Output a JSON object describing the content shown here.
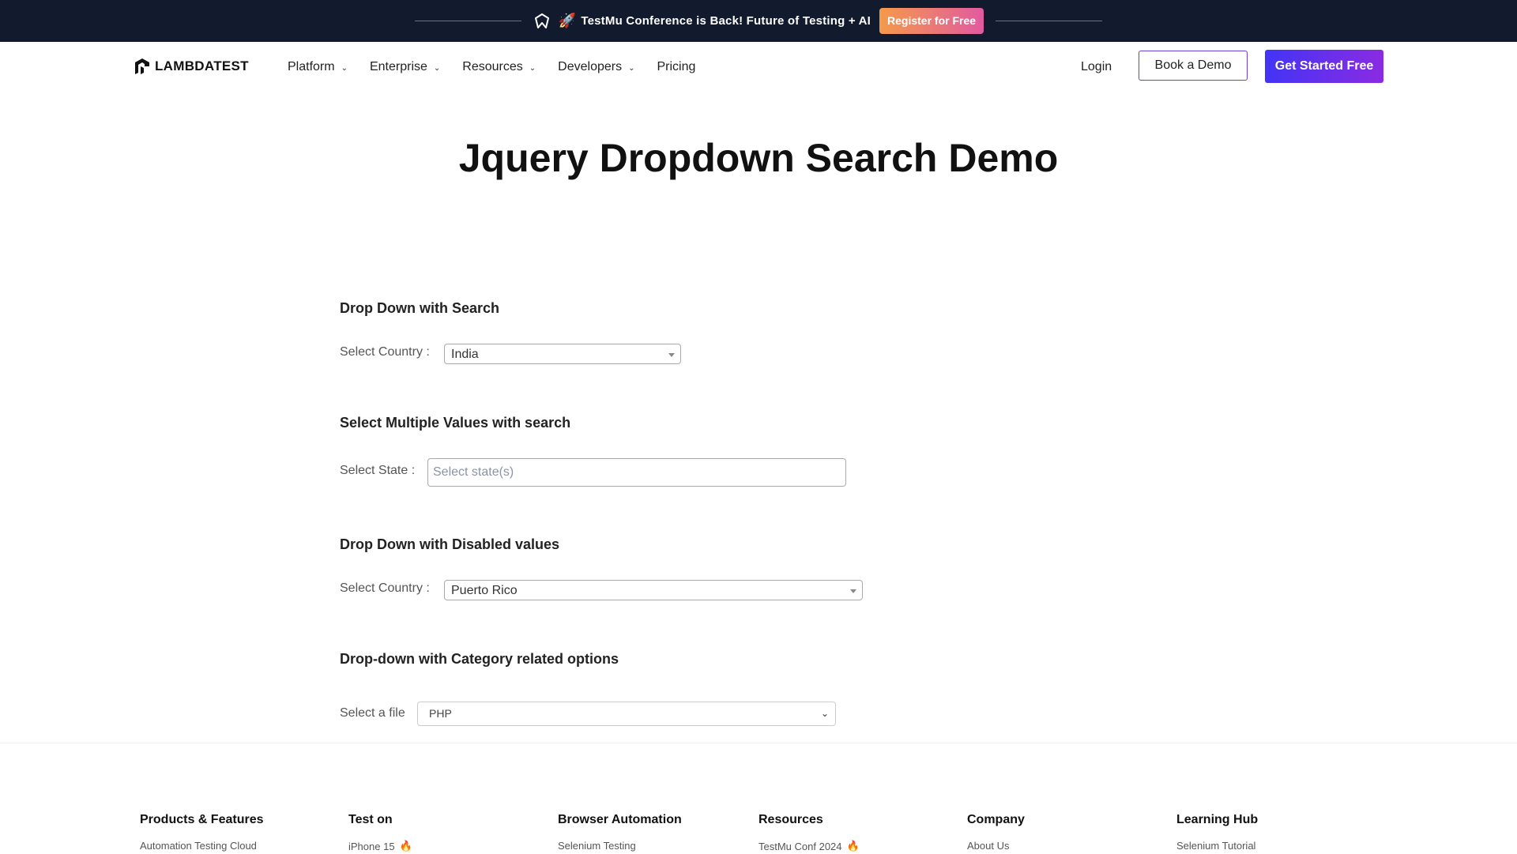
{
  "banner": {
    "logo_icon": "testmu-logo-icon",
    "rocket_icon": "rocket-icon",
    "text": "TestMu Conference is Back! Future of Testing + AI",
    "button": "Register for Free"
  },
  "nav": {
    "logo_text": "LAMBDATEST",
    "items": [
      {
        "label": "Platform",
        "has_dropdown": true
      },
      {
        "label": "Enterprise",
        "has_dropdown": true
      },
      {
        "label": "Resources",
        "has_dropdown": true
      },
      {
        "label": "Developers",
        "has_dropdown": true
      },
      {
        "label": "Pricing",
        "has_dropdown": false
      }
    ],
    "login": "Login",
    "book_demo": "Book a Demo",
    "get_started": "Get Started Free"
  },
  "page": {
    "title": "Jquery Dropdown Search Demo"
  },
  "sections": {
    "search": {
      "heading": "Drop Down with Search",
      "label": "Select Country :",
      "value": "India"
    },
    "multiple": {
      "heading": "Select Multiple Values with search",
      "label": "Select State :",
      "placeholder": "Select state(s)"
    },
    "disabled": {
      "heading": "Drop Down with Disabled values",
      "label": "Select Country :",
      "value": "Puerto Rico"
    },
    "category": {
      "heading": "Drop-down with Category related options",
      "label": "Select a file",
      "value": "PHP"
    }
  },
  "footer": {
    "columns": [
      {
        "heading": "Products & Features",
        "link": "Automation Testing Cloud",
        "fire": false
      },
      {
        "heading": "Test on",
        "link": "iPhone 15",
        "fire": true
      },
      {
        "heading": "Browser Automation",
        "link": "Selenium Testing",
        "fire": false
      },
      {
        "heading": "Resources",
        "link": "TestMu Conf 2024",
        "fire": true
      },
      {
        "heading": "Company",
        "link": "About Us",
        "fire": false
      },
      {
        "heading": "Learning Hub",
        "link": "Selenium Tutorial",
        "fire": false
      }
    ]
  }
}
